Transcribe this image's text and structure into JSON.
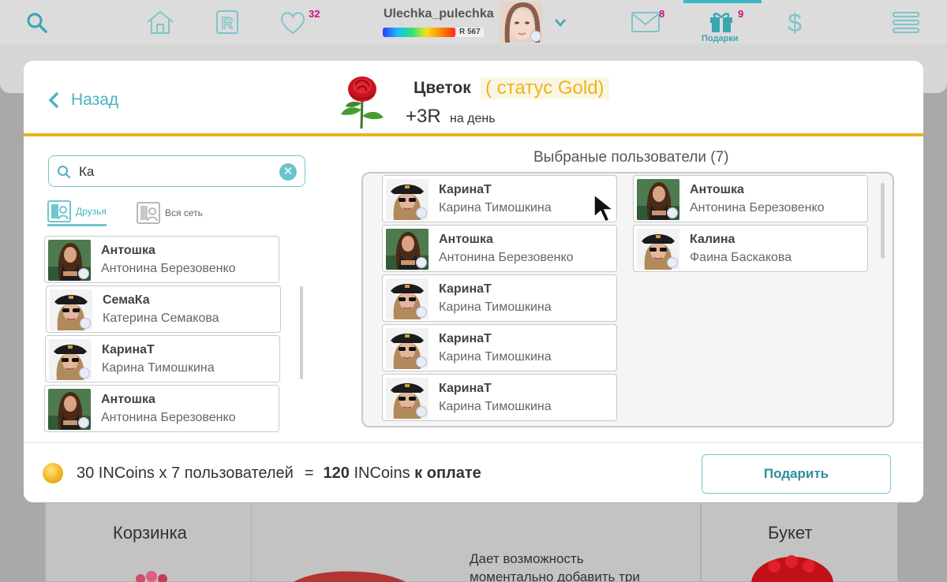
{
  "topbar": {
    "likes_badge": "32",
    "user_name": "Ulechka_pulechka",
    "rating": "R 567",
    "messages_badge": "8",
    "gifts_badge": "9",
    "gifts_label": "Подарки",
    "accent_color": "#3bb8c2",
    "badge_color": "#c4137e"
  },
  "modal": {
    "back_label": "Назад",
    "item_title": "Цветок",
    "item_status": "( статус Gold)",
    "item_bonus": "+3R",
    "item_bonus_sub": "на день",
    "search": {
      "value": "Ка",
      "placeholder": ""
    },
    "tabs": [
      {
        "label": "Друзья",
        "active": true
      },
      {
        "label": "Вся сеть",
        "active": false
      }
    ],
    "friends": [
      {
        "nick": "Антошка",
        "name": "Антонина Березовенко",
        "photo": "girl"
      },
      {
        "nick": "СемаКа",
        "name": "Катерина Семакова",
        "photo": "pilot"
      },
      {
        "nick": "КаринаТ",
        "name": "Карина Тимошкина",
        "photo": "pilot"
      },
      {
        "nick": "Антошка",
        "name": "Антонина Березовенко",
        "photo": "girl"
      }
    ],
    "selected_title": "Выбраные пользователи (7)",
    "selected": [
      {
        "nick": "КаринаТ",
        "name": "Карина Тимошкина",
        "photo": "pilot"
      },
      {
        "nick": "Антошка",
        "name": "Антонина Березовенко",
        "photo": "girl"
      },
      {
        "nick": "КаринаТ",
        "name": "Карина Тимошкина",
        "photo": "pilot"
      },
      {
        "nick": "КаринаТ",
        "name": "Карина Тимошкина",
        "photo": "pilot"
      },
      {
        "nick": "КаринаТ",
        "name": "Карина Тимошкина",
        "photo": "pilot"
      },
      {
        "nick": "Антошка",
        "name": "Антонина Березовенко",
        "photo": "girl"
      },
      {
        "nick": "Калина",
        "name": "Фаина Баскакова",
        "photo": "pilot"
      }
    ],
    "footer": {
      "price_part": "30 INCoins x 7 пользователей",
      "equals": "=",
      "total_num": "120",
      "total_unit": "INCoins",
      "total_suffix": "к оплате",
      "gift_button": "Подарить"
    },
    "status_color": "#f0b21a"
  },
  "background": {
    "card_left_title": "Корзинка",
    "card_right_title": "Букет",
    "description": "Дает возможность моментально добавить три"
  }
}
